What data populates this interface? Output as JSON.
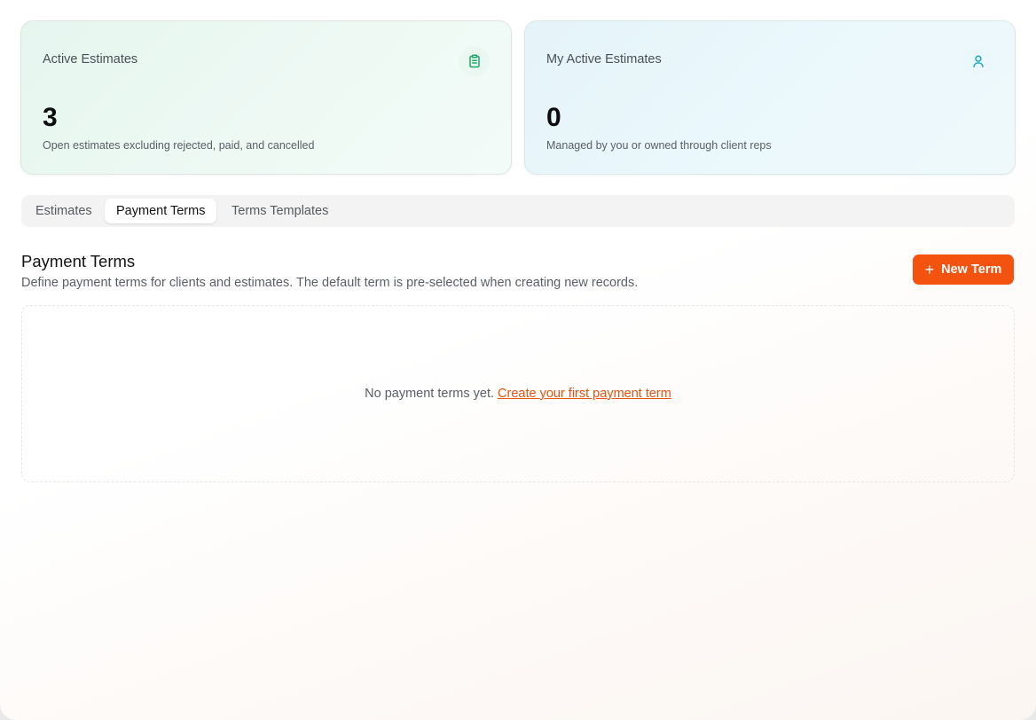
{
  "stats": [
    {
      "label": "Active Estimates",
      "value": "3",
      "description": "Open estimates excluding rejected, paid, and cancelled",
      "icon": "clipboard-icon",
      "accent": "#1fa86a"
    },
    {
      "label": "My Active Estimates",
      "value": "0",
      "description": "Managed by you or owned through client reps",
      "icon": "user-icon",
      "accent": "#1aa8c4"
    }
  ],
  "tabs": [
    {
      "label": "Estimates",
      "active": false
    },
    {
      "label": "Payment Terms",
      "active": true
    },
    {
      "label": "Terms Templates",
      "active": false
    }
  ],
  "section": {
    "title": "Payment Terms",
    "description": "Define payment terms for clients and estimates. The default term is pre-selected when creating new records."
  },
  "new_term_button": {
    "label": "New Term",
    "icon": "plus-icon",
    "color": "#f3530e"
  },
  "empty_state": {
    "text": "No payment terms yet.",
    "link": "Create your first payment term",
    "link_color": "#e8520f"
  }
}
